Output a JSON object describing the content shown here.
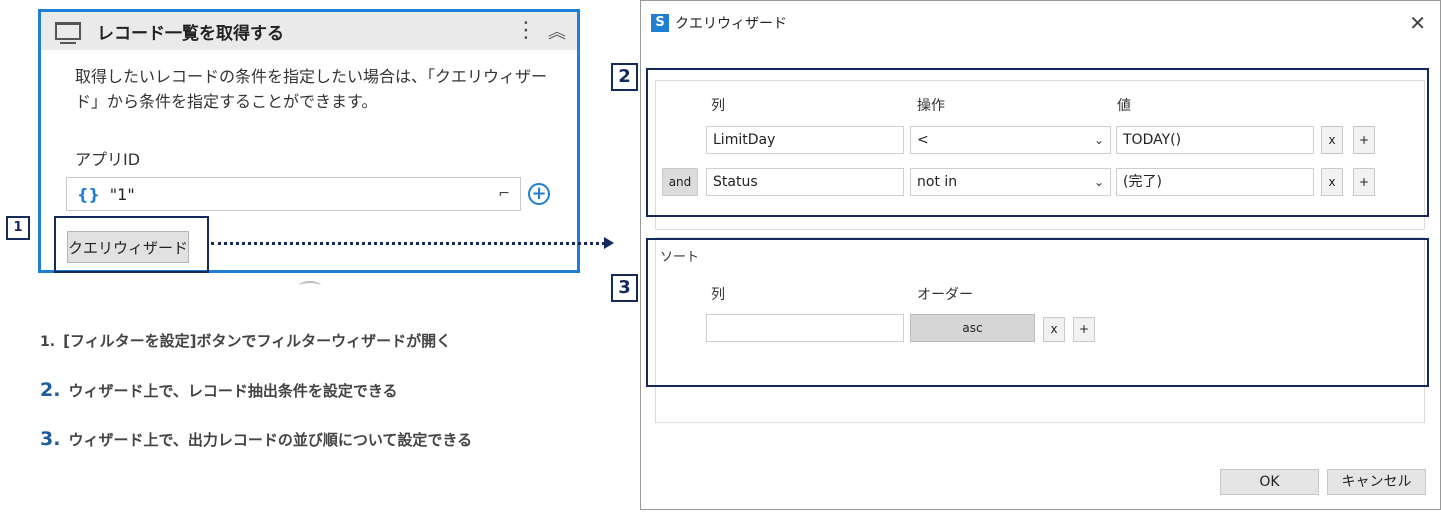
{
  "activity": {
    "title": "レコード一覧を取得する",
    "menu_icon": "⋮",
    "collapse_icon": "︽",
    "description": "取得したいレコードの条件を指定したい場合は、「クエリウィザード」から条件を指定することができます。",
    "app_id_label": "アプリID",
    "app_id_braces": "{}",
    "app_id_value": "\"1\"",
    "expand_icon": "⌐",
    "plus_icon": "+",
    "wizard_button": "クエリウィザード"
  },
  "markers": {
    "m1": "1",
    "m2": "2",
    "m3": "3"
  },
  "notes": [
    {
      "num": "1.",
      "text": "[フィルターを設定]ボタンでフィルターウィザードが開く"
    },
    {
      "num": "2.",
      "text": "ウィザード上で、レコード抽出条件を設定できる"
    },
    {
      "num": "3.",
      "text": "ウィザード上で、出力レコードの並び順について設定できる"
    }
  ],
  "dialog": {
    "logo": "S",
    "title": "クエリウィザード",
    "close_icon": "✕",
    "filter": {
      "headers": {
        "column": "列",
        "operation": "操作",
        "value": "値"
      },
      "rows": [
        {
          "connector": "",
          "column": "LimitDay",
          "operation": "<",
          "value": "TODAY()",
          "remove": "x",
          "add": "+"
        },
        {
          "connector": "and",
          "column": "Status",
          "operation": "not in",
          "value": "(完了)",
          "remove": "x",
          "add": "+"
        }
      ],
      "dropdown_icon": "⌄"
    },
    "sort": {
      "section_label": "ソート",
      "headers": {
        "column": "列",
        "order": "オーダー"
      },
      "row": {
        "column": "",
        "order": "asc",
        "remove": "x",
        "add": "+"
      }
    },
    "ok": "OK",
    "cancel": "キャンセル"
  },
  "colors": {
    "accent": "#1e7fd4",
    "highlight_border": "#14295c",
    "note_number": "#1e5a9e"
  }
}
